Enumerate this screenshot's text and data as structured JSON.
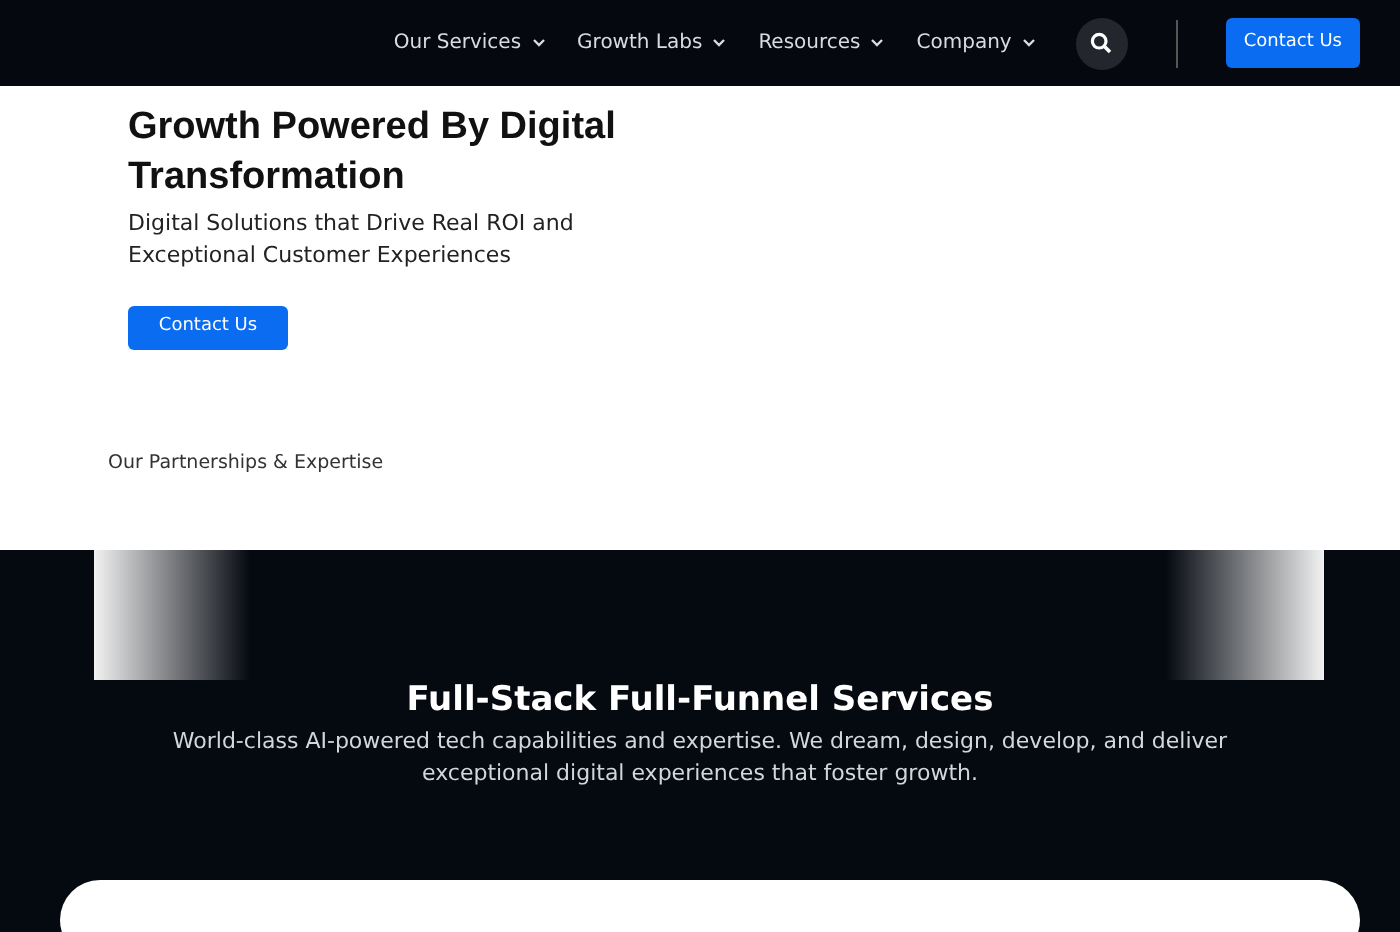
{
  "navbar": {
    "items": [
      {
        "label": "Our Services",
        "has_dropdown": true
      },
      {
        "label": "Growth Labs",
        "has_dropdown": true
      },
      {
        "label": "Resources",
        "has_dropdown": true
      },
      {
        "label": "Company",
        "has_dropdown": true
      }
    ],
    "cta": "Contact Us"
  },
  "hero": {
    "title": "Growth Powered By Digital Transformation",
    "subtitle": "Digital Solutions that Drive Real ROI and Exceptional Customer Experiences",
    "button": "Contact Us"
  },
  "partners": {
    "label": "Our Partnerships & Expertise"
  },
  "services": {
    "title": "Full-Stack Full-Funnel Services",
    "description": "World-class AI-powered tech capabilities and expertise. We dream, design, develop, and deliver exceptional digital experiences that foster growth."
  }
}
